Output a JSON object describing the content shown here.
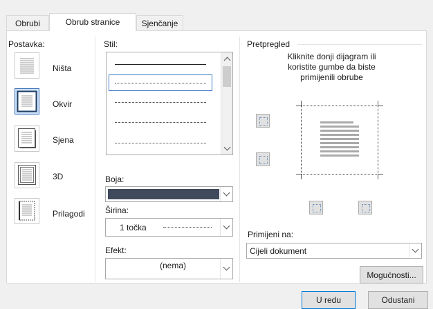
{
  "tabs": [
    {
      "label": "Obrubi",
      "mnemonic_index": 1
    },
    {
      "label": "Obrub stranice",
      "mnemonic_index": 8
    },
    {
      "label": "Sjenčanje",
      "mnemonic_index": 0
    }
  ],
  "active_tab": "Obrub stranice",
  "setting": {
    "label": "Postavka:",
    "items": [
      {
        "label": "Ništa",
        "icon": "none-border-icon",
        "selected": false
      },
      {
        "label": "Okvir",
        "icon": "box-border-icon",
        "selected": true
      },
      {
        "label": "Sjena",
        "icon": "shadow-border-icon",
        "selected": false
      },
      {
        "label": "3D",
        "icon": "3d-border-icon",
        "selected": false
      },
      {
        "label": "Prilagodi",
        "icon": "custom-border-icon",
        "selected": false
      }
    ]
  },
  "style": {
    "label": "Stil:",
    "line_styles": [
      "solid",
      "dotted-fine",
      "dotted",
      "dashed",
      "dash-dot"
    ],
    "selected_index": 1
  },
  "color": {
    "label": "Boja:",
    "value": "#3f4a5c"
  },
  "width": {
    "label": "Širina:",
    "value": "1 točka"
  },
  "art": {
    "label": "Efekt:",
    "value": "(nema)"
  },
  "preview": {
    "label": "Pretpregled",
    "instructions": "Kliknite donji dijagram ili koristite gumbe da biste primijenili obrube"
  },
  "apply_to": {
    "label": "Primijeni na:",
    "value": "Cijeli dokument"
  },
  "options_button": "Mogućnosti...",
  "ok_button": "U redu",
  "cancel_button": "Odustani"
}
